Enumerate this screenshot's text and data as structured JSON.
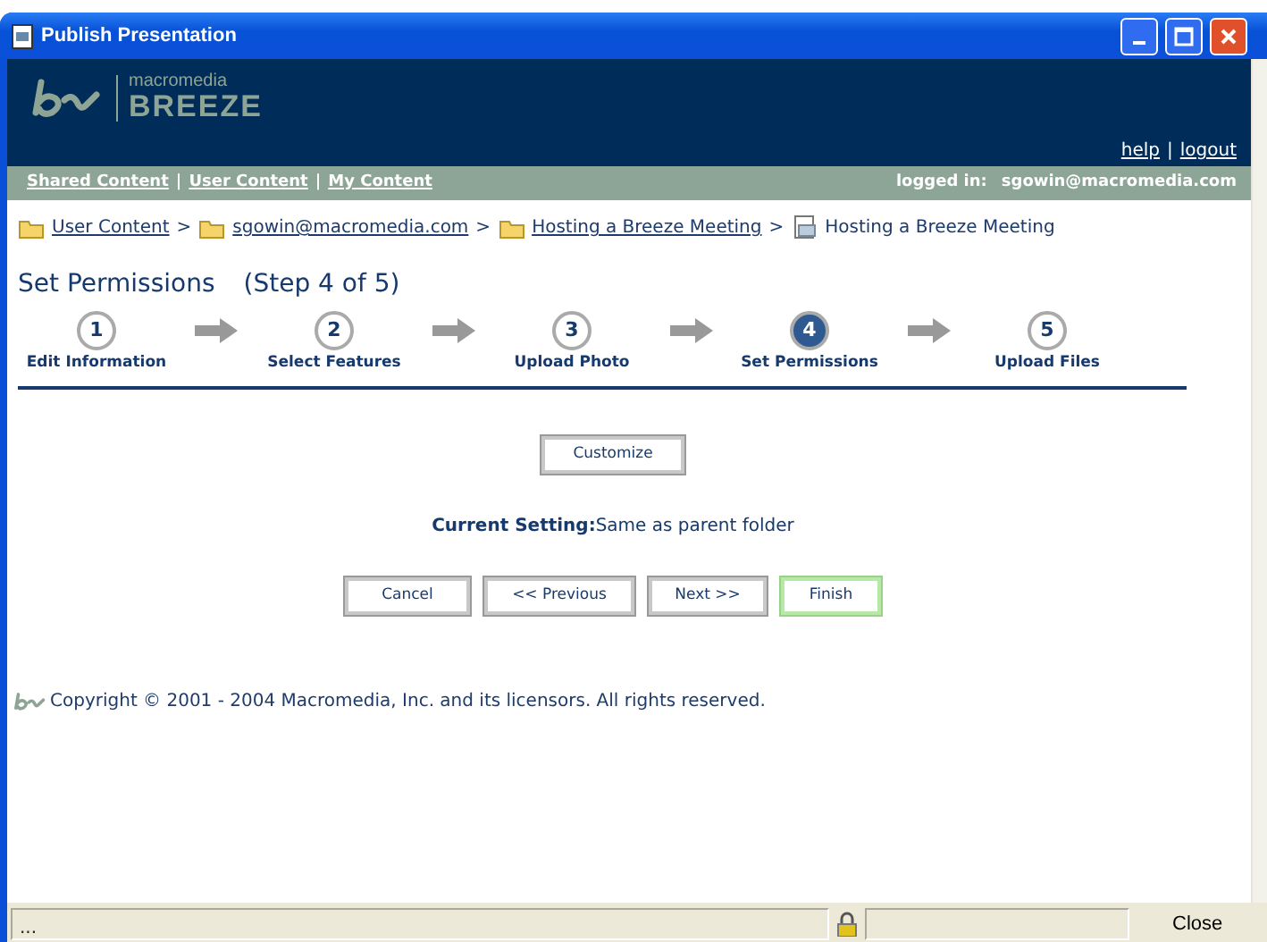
{
  "window": {
    "title": "Publish Presentation"
  },
  "header": {
    "logo_brand": "macromedia",
    "logo_product": "BREEZE",
    "links": [
      "help",
      "logout"
    ],
    "link_separator": "|"
  },
  "nav": {
    "items": [
      "Shared Content",
      "User Content",
      "My Content"
    ],
    "separator": "|",
    "logged_in_label": "logged in:",
    "user": "sgowin@macromedia.com"
  },
  "breadcrumb": {
    "separator": ">",
    "items": [
      {
        "kind": "folder",
        "text": "User Content",
        "link": true
      },
      {
        "kind": "folder",
        "text": "sgowin@macromedia.com",
        "link": true
      },
      {
        "kind": "folder",
        "text": "Hosting a Breeze Meeting",
        "link": true
      },
      {
        "kind": "document",
        "text": "Hosting a Breeze Meeting",
        "link": false
      }
    ]
  },
  "heading": {
    "title": "Set Permissions",
    "step": "(Step 4 of 5)"
  },
  "steps": [
    {
      "number": "1",
      "label": "Edit Information",
      "selected": false
    },
    {
      "number": "2",
      "label": "Select Features",
      "selected": false
    },
    {
      "number": "3",
      "label": "Upload Photo",
      "selected": false
    },
    {
      "number": "4",
      "label": "Set Permissions",
      "selected": true
    },
    {
      "number": "5",
      "label": "Upload Files",
      "selected": false
    }
  ],
  "customize_button": "Customize",
  "current_setting": {
    "label": "Current Setting:",
    "value": "Same as parent folder"
  },
  "buttons": [
    {
      "label": "Cancel",
      "default": false
    },
    {
      "label": "<< Previous",
      "default": false
    },
    {
      "label": "Next >>",
      "default": false
    },
    {
      "label": "Finish",
      "default": true
    }
  ],
  "copyright": "Copyright © 2001 - 2004 Macromedia, Inc. and its licensors. All rights reserved.",
  "status_bar": {
    "text": "...",
    "close_button": "Close"
  }
}
